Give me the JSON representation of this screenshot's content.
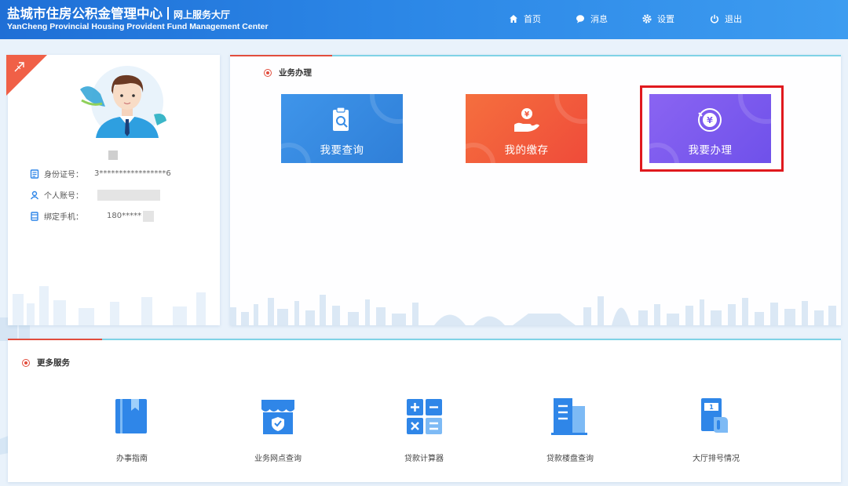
{
  "header": {
    "title_cn": "盐城市住房公积金管理中心",
    "subtitle_cn": "网上服务大厅",
    "title_en": "YanCheng Provincial Housing Provident Fund Management Center",
    "nav": [
      {
        "label": "首页",
        "icon": "home-icon"
      },
      {
        "label": "消息",
        "icon": "message-icon"
      },
      {
        "label": "设置",
        "icon": "gear-icon"
      },
      {
        "label": "退出",
        "icon": "power-icon"
      }
    ]
  },
  "profile": {
    "name_masked": "■",
    "id_label": "身份证号：",
    "id_value": "3*****************6",
    "account_label": "个人账号：",
    "account_value": "",
    "phone_label": "绑定手机：",
    "phone_value": "180*****"
  },
  "business": {
    "title": "业务办理",
    "tiles": [
      {
        "label": "我要查询",
        "icon": "clipboard-search-icon",
        "color": "#3a8ee6"
      },
      {
        "label": "我的缴存",
        "icon": "hand-yen-icon",
        "color": "#f2583c"
      },
      {
        "label": "我要办理",
        "icon": "yen-coin-icon",
        "color": "#7d5cf0"
      }
    ]
  },
  "more_services": {
    "title": "更多服务",
    "items": [
      {
        "label": "办事指南",
        "icon": "book-icon"
      },
      {
        "label": "业务网点查询",
        "icon": "shop-icon"
      },
      {
        "label": "贷款计算器",
        "icon": "calculator-icon"
      },
      {
        "label": "贷款楼盘查询",
        "icon": "building-icon"
      },
      {
        "label": "大厅排号情况",
        "icon": "ticket-icon"
      }
    ]
  },
  "colors": {
    "header_blue": "#2b86e6",
    "accent_red": "#e24d3d",
    "highlight_red": "#e0191e",
    "icon_blue": "#2f86e8"
  }
}
